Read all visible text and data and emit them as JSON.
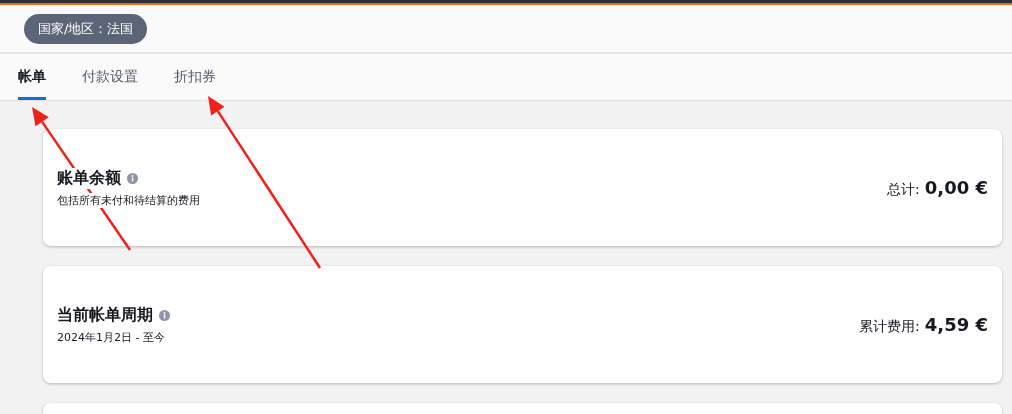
{
  "region_pill": "国家/地区：法国",
  "tabs": [
    {
      "label": "帐单",
      "selected": true
    },
    {
      "label": "付款设置",
      "selected": false
    },
    {
      "label": "折扣券",
      "selected": false
    }
  ],
  "cards": [
    {
      "kind": "summary",
      "title": "账单余额",
      "subtitle": "包括所有未付和待结算的费用",
      "total_label": "总计:",
      "total_value": "0,00 €"
    },
    {
      "kind": "summary",
      "title": "当前帐单周期",
      "subtitle": "2024年1月2日 - 至今",
      "total_label": "累计费用:",
      "total_value": "4,59 €"
    },
    {
      "kind": "blank"
    }
  ],
  "annotations": [
    {
      "kind": "arrow"
    },
    {
      "kind": "arrow"
    }
  ]
}
